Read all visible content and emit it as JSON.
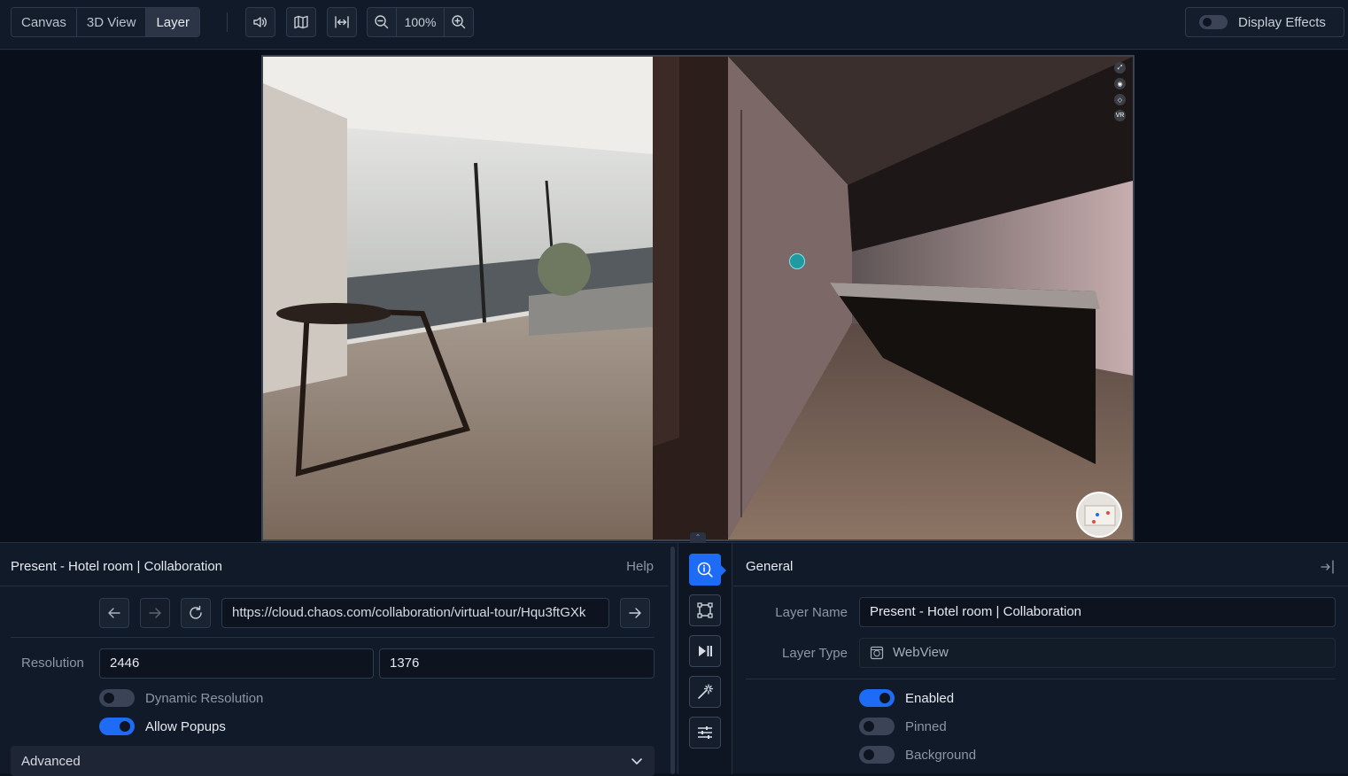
{
  "toolbar": {
    "views": [
      "Canvas",
      "3D View",
      "Layer"
    ],
    "active_view": "Layer",
    "zoom": "100%",
    "display_effects_label": "Display Effects",
    "display_effects_on": false
  },
  "left_panel": {
    "title": "Present - Hotel room | Collaboration",
    "help_label": "Help",
    "url": "https://cloud.chaos.com/collaboration/virtual-tour/Hqu3ftGXk",
    "resolution_label": "Resolution",
    "resolution_width": "2446",
    "resolution_height": "1376",
    "dynamic_resolution_label": "Dynamic Resolution",
    "dynamic_resolution_on": false,
    "allow_popups_label": "Allow Popups",
    "allow_popups_on": true,
    "advanced_label": "Advanced"
  },
  "right_panel": {
    "section_title": "General",
    "layer_name_label": "Layer Name",
    "layer_name": "Present - Hotel room | Collaboration",
    "layer_type_label": "Layer Type",
    "layer_type": "WebView",
    "enabled_label": "Enabled",
    "enabled_on": true,
    "pinned_label": "Pinned",
    "pinned_on": false,
    "background_label": "Background",
    "background_on": false
  },
  "scene_controls": [
    "expand-icon",
    "eye-icon",
    "tag-icon",
    "vr-icon"
  ],
  "scene_controls_text": {
    "vr": "VR"
  },
  "colors": {
    "accent": "#1e6cf5",
    "bg": "#111a28",
    "panel_bg": "#0c1320"
  }
}
